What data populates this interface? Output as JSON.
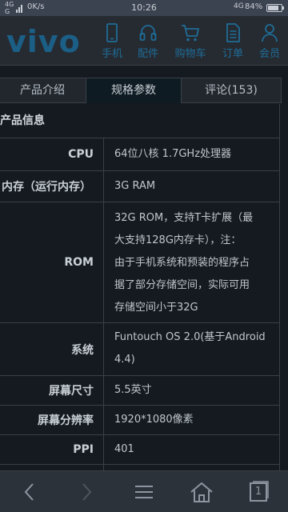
{
  "status": {
    "signal_top": "4G",
    "signal_bottom": "G",
    "speed": "0K/s",
    "time": "10:26",
    "network": "4G",
    "battery_percent": "84%",
    "battery_level": 0.84
  },
  "header": {
    "logo": "vivo",
    "nav": [
      {
        "label": "手机",
        "icon": "phone-icon"
      },
      {
        "label": "配件",
        "icon": "headphones-icon"
      },
      {
        "label": "购物车",
        "icon": "cart-icon"
      },
      {
        "label": "订单",
        "icon": "document-icon"
      },
      {
        "label": "会员",
        "icon": "user-icon"
      }
    ]
  },
  "tabs": [
    {
      "label": "产品介绍",
      "active": false
    },
    {
      "label": "规格参数",
      "active": true
    },
    {
      "label": "评论(153)",
      "active": false
    }
  ],
  "specs": {
    "section_title": "产品信息",
    "rows": [
      {
        "key": "CPU",
        "lines": [
          "64位八核 1.7GHz处理器"
        ]
      },
      {
        "key": "内存（运行内存）",
        "lines": [
          "3G RAM"
        ]
      },
      {
        "key": "ROM",
        "lines": [
          "32G ROM，支持T卡扩展（最",
          "大支持128G内存卡），注：",
          "由于手机系统和预装的程序占",
          "据了部分存储空间，实际可用",
          "存储空间小于32G"
        ]
      },
      {
        "key": "系统",
        "lines": [
          "Funtouch OS 2.0(基于Android",
          "4.4)"
        ]
      },
      {
        "key": "屏幕尺寸",
        "lines": [
          "5.5英寸"
        ]
      },
      {
        "key": "屏幕分辨率",
        "lines": [
          "1920*1080像素"
        ]
      },
      {
        "key": "PPI",
        "lines": [
          "401"
        ]
      }
    ]
  },
  "bottom_bar": [
    {
      "icon": "back-icon"
    },
    {
      "icon": "forward-icon"
    },
    {
      "icon": "menu-icon"
    },
    {
      "icon": "home-icon"
    },
    {
      "icon": "tabs-icon",
      "label": "1"
    }
  ]
}
